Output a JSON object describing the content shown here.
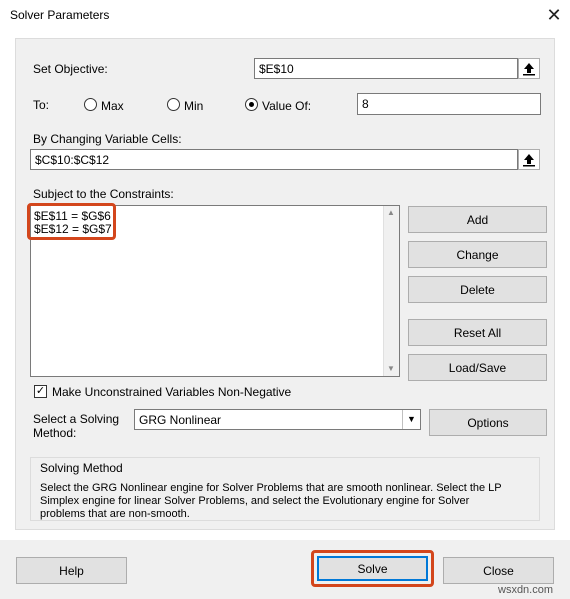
{
  "window": {
    "title": "Solver Parameters",
    "close_icon": "✕"
  },
  "objective": {
    "label": "Set Objective:",
    "label_underline_char": "t",
    "value": "$E$10"
  },
  "to": {
    "label": "To:",
    "options": [
      {
        "label": "Max",
        "selected": false
      },
      {
        "label": "Min",
        "selected": false
      },
      {
        "label": "Value Of:",
        "selected": true
      }
    ],
    "value_of": "8"
  },
  "changing_cells": {
    "label": "By Changing Variable Cells:",
    "value": "$C$10:$C$12"
  },
  "constraints": {
    "label": "Subject to the Constraints:",
    "items": [
      "$E$11 = $G$6",
      "$E$12 = $G$7"
    ]
  },
  "constraint_buttons": {
    "add": "Add",
    "change": "Change",
    "delete": "Delete",
    "reset_all": "Reset All",
    "load_save": "Load/Save"
  },
  "nonneg": {
    "label": "Make Unconstrained Variables Non-Negative",
    "checked": true
  },
  "method": {
    "label_line1": "Select a Solving",
    "label_line2": "Method:",
    "value": "GRG Nonlinear",
    "options_button": "Options"
  },
  "solving_method": {
    "title": "Solving Method",
    "text_line1": "Select the GRG Nonlinear engine for Solver Problems that are smooth nonlinear. Select the LP",
    "text_line2": "Simplex engine for linear Solver Problems, and select the Evolutionary engine for Solver",
    "text_line3": "problems that are non-smooth."
  },
  "footer": {
    "help": "Help",
    "solve": "Solve",
    "close": "Close"
  },
  "watermark": "wsxdn.com",
  "colors": {
    "highlight": "#d3461c",
    "panel": "#f0f0f0"
  }
}
